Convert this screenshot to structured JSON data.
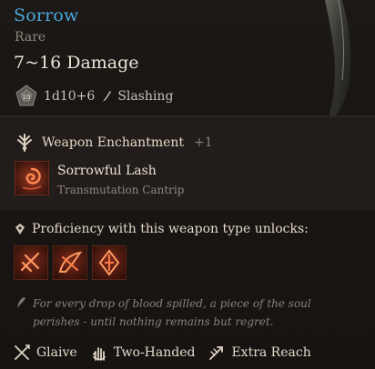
{
  "item": {
    "name": "Sorrow",
    "rarity": "Rare",
    "damage": "7~16 Damage",
    "dice": "1d10+6",
    "damage_type": "Slashing",
    "die_label": "10",
    "colors": {
      "name": "#4aa7d9",
      "subtle": "#8f877c",
      "text": "#ece4d6"
    }
  },
  "enchantment": {
    "label": "Weapon Enchantment",
    "bonus": "+1",
    "icon": "weapon-enchantment-icon"
  },
  "spell": {
    "name": "Sorrowful Lash",
    "school": "Transmutation Cantrip",
    "icon": "sorrowful-lash-icon"
  },
  "proficiency": {
    "label": "Proficiency with this weapon type unlocks:",
    "actions": [
      {
        "icon": "action-icon-1"
      },
      {
        "icon": "action-icon-2"
      },
      {
        "icon": "action-icon-3"
      }
    ]
  },
  "flavor": "For every drop of blood spilled, a piece of the soul perishes - until nothing remains but regret.",
  "properties": [
    {
      "label": "Glaive",
      "icon": "glaive-icon"
    },
    {
      "label": "Two-Handed",
      "icon": "two-handed-icon"
    },
    {
      "label": "Extra Reach",
      "icon": "extra-reach-icon"
    }
  ]
}
